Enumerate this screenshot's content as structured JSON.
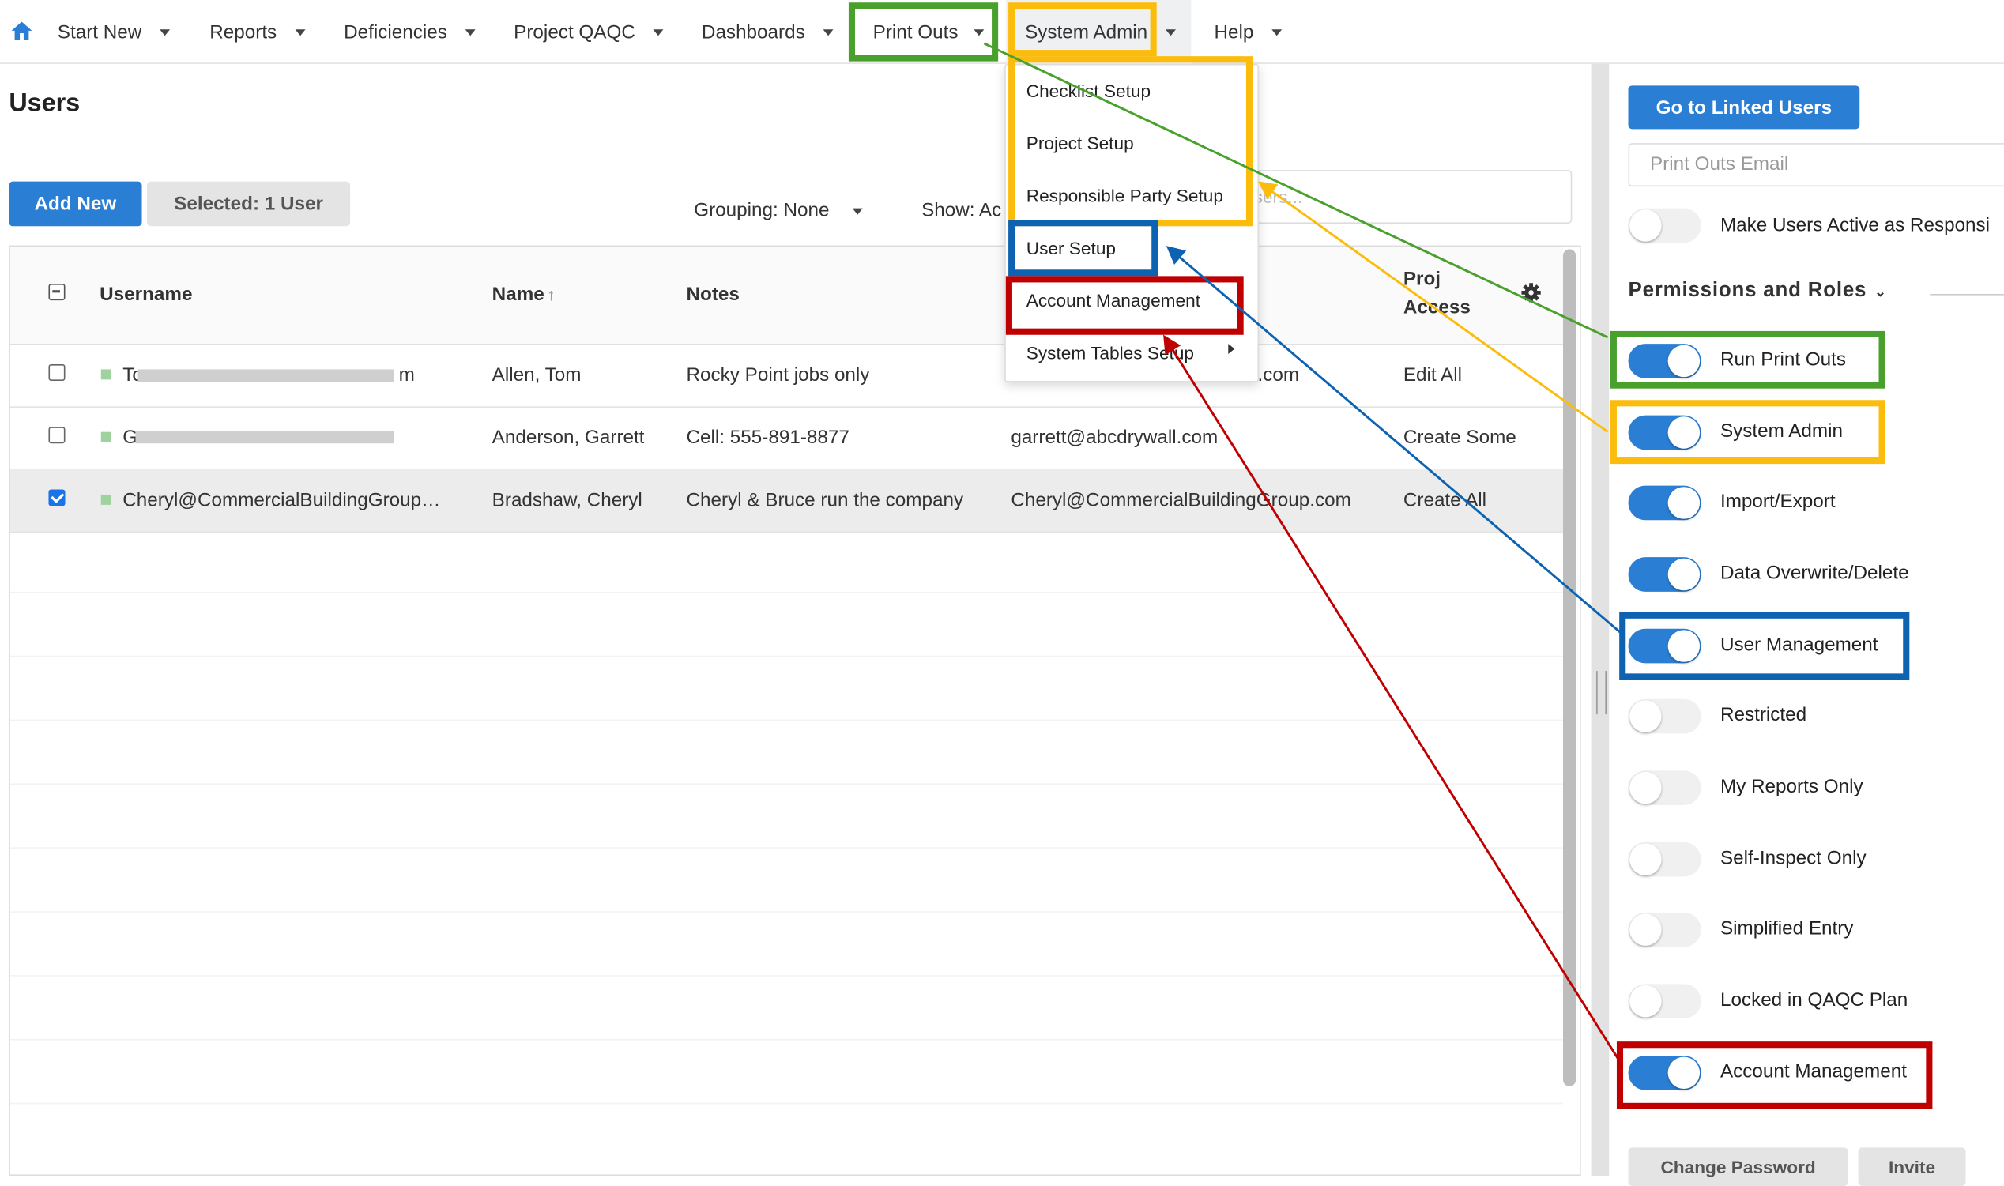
{
  "nav": {
    "items": [
      "Start New",
      "Reports",
      "Deficiencies",
      "Project QAQC",
      "Dashboards",
      "Print Outs",
      "System Admin",
      "Help"
    ]
  },
  "left": {
    "title": "Users",
    "add_new": "Add New",
    "selected": "Selected: 1 User",
    "grouping": "Grouping: None",
    "show": "Show: Ac",
    "search_placeholder": "sers..."
  },
  "table": {
    "headers": [
      "Username",
      "Name",
      "Notes",
      "Proj Access"
    ],
    "headers_proj_line1": "Proj",
    "headers_proj_line2": "Access",
    "rows": [
      {
        "username_start": "To",
        "username_end": "m",
        "name": "Allen, Tom",
        "notes": "Rocky Point jobs only",
        "email_end": ".com",
        "access": "Edit All",
        "checked": false
      },
      {
        "username_start": "G",
        "username_end": "",
        "name": "Anderson, Garrett",
        "notes": "Cell: 555-891-8877",
        "email": "garrett@abcdrywall.com",
        "access": "Create Some",
        "checked": false
      },
      {
        "username": "Cheryl@CommercialBuildingGroup…",
        "name": "Bradshaw, Cheryl",
        "notes": "Cheryl & Bruce run the company",
        "email": "Cheryl@CommercialBuildingGroup.com",
        "access": "Create All",
        "checked": true
      }
    ]
  },
  "dropdown": {
    "items": [
      "Checklist Setup",
      "Project Setup",
      "Responsible Party Setup",
      "User Setup",
      "Account Management",
      "System Tables Setup"
    ]
  },
  "right": {
    "linked_button": "Go to Linked Users",
    "email_placeholder": "Print Outs Email",
    "make_active": "Make Users Active as Responsi",
    "section_title": "Permissions and Roles",
    "permissions": [
      {
        "label": "Run Print Outs",
        "on": true
      },
      {
        "label": "System Admin",
        "on": true
      },
      {
        "label": "Import/Export",
        "on": true
      },
      {
        "label": "Data Overwrite/Delete",
        "on": true
      },
      {
        "label": "User Management",
        "on": true
      },
      {
        "label": "Restricted",
        "on": false
      },
      {
        "label": "My Reports Only",
        "on": false
      },
      {
        "label": "Self-Inspect Only",
        "on": false
      },
      {
        "label": "Simplified Entry",
        "on": false
      },
      {
        "label": "Locked in QAQC Plan",
        "on": false
      },
      {
        "label": "Account Management",
        "on": true
      }
    ],
    "change_password": "Change Password",
    "invite": "Invite"
  },
  "colors": {
    "primary": "#2a7fd4",
    "annotation_green": "#4aa02c",
    "annotation_yellow": "#fbbc0b",
    "annotation_blue": "#0d63b1",
    "annotation_red": "#c00000"
  }
}
